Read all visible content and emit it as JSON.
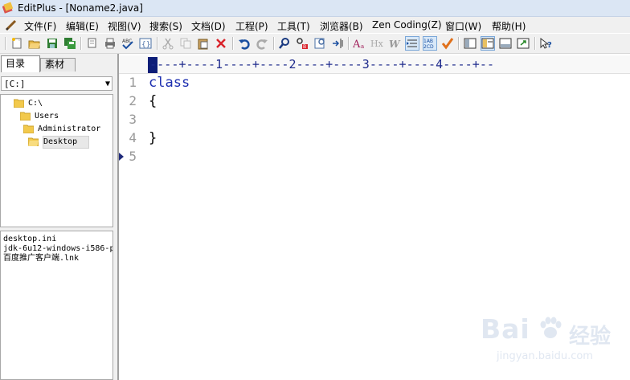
{
  "window": {
    "title": "EditPlus - [Noname2.java]"
  },
  "menu": [
    {
      "label": "文件(F)"
    },
    {
      "label": "编辑(E)"
    },
    {
      "label": "视图(V)"
    },
    {
      "label": "搜索(S)"
    },
    {
      "label": "文档(D)"
    },
    {
      "label": "工程(P)"
    },
    {
      "label": "工具(T)"
    },
    {
      "label": "浏览器(B)"
    },
    {
      "label": "Zen Coding(Z)"
    },
    {
      "label": "窗口(W)"
    },
    {
      "label": "帮助(H)"
    }
  ],
  "sidebar": {
    "tabs": [
      {
        "label": "目录"
      },
      {
        "label": "素材"
      }
    ],
    "drive": "[C:]",
    "tree": [
      {
        "label": "C:\\"
      },
      {
        "label": "Users"
      },
      {
        "label": "Administrator"
      },
      {
        "label": "Desktop"
      }
    ],
    "files": [
      {
        "label": "desktop.ini"
      },
      {
        "label": "jdk-6u12-windows-i586-p"
      },
      {
        "label": "百度推广客户端.lnk"
      }
    ]
  },
  "editor": {
    "ruler": "----+----1----+----2----+----3----+----4----+--",
    "lines": [
      {
        "num": "1",
        "text": "class"
      },
      {
        "num": "2",
        "text": "{"
      },
      {
        "num": "3",
        "text": ""
      },
      {
        "num": "4",
        "text": "}"
      },
      {
        "num": "5",
        "text": ""
      }
    ]
  },
  "watermark": {
    "brand": "Bai",
    "site_text": "经验",
    "url": "jingyan.baidu.com"
  },
  "colors": {
    "keyword": "#1d2fb0",
    "ruler": "#1e2a8c",
    "line_numbers": "#9a9a9a"
  }
}
